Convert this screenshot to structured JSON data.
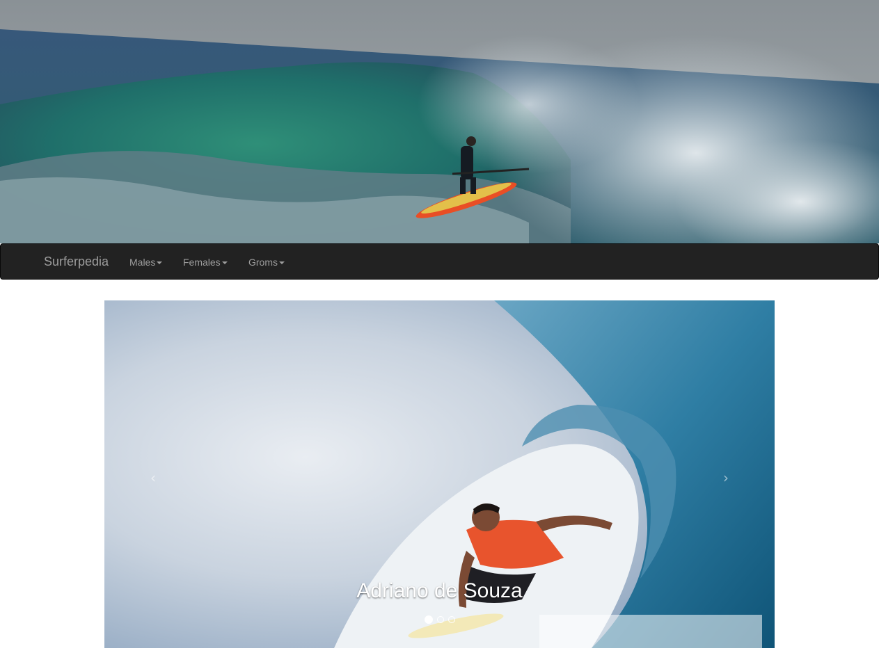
{
  "navbar": {
    "brand": "Surferpedia",
    "items": [
      {
        "label": "Males"
      },
      {
        "label": "Females"
      },
      {
        "label": "Groms"
      }
    ]
  },
  "carousel": {
    "caption": "Adriano de Souza",
    "slide_count": 3,
    "active_slide": 1,
    "prev_icon": "chevron-left-icon",
    "next_icon": "chevron-right-icon"
  },
  "colors": {
    "navbar_bg": "#222222",
    "nav_text": "#9d9d9d"
  }
}
